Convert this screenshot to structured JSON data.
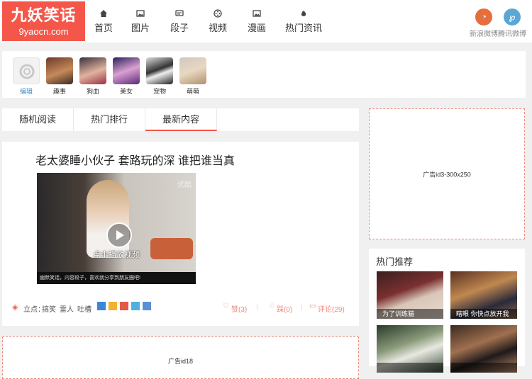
{
  "logo": {
    "title": "九妖笑话",
    "domain": "9yaocn.com"
  },
  "nav": [
    {
      "label": "首页",
      "icon": "home-icon"
    },
    {
      "label": "图片",
      "icon": "image-icon"
    },
    {
      "label": "段子",
      "icon": "chat-icon"
    },
    {
      "label": "视频",
      "icon": "video-icon"
    },
    {
      "label": "漫画",
      "icon": "comic-icon"
    },
    {
      "label": "热门资讯",
      "icon": "fire-icon"
    }
  ],
  "login": {
    "weibo_label": "新浪微博",
    "tencent_label": "腾讯微博"
  },
  "categories": {
    "edit_label": "编辑",
    "items": [
      {
        "label": "趣事"
      },
      {
        "label": "狗血"
      },
      {
        "label": "美女"
      },
      {
        "label": "宠物"
      },
      {
        "label": "萌萌"
      }
    ]
  },
  "tabs": [
    {
      "label": "随机阅读",
      "active": false
    },
    {
      "label": "热门排行",
      "active": false
    },
    {
      "label": "最新内容",
      "active": true
    }
  ],
  "post": {
    "title": "老太婆睡小伙子 套路玩的深 谁把谁当真",
    "video_watermark": "优酷",
    "video_caption": "点击播放视频",
    "video_footer": "幽默笑话，内容段子，喜欢就分享到朋友圈吧!",
    "tag_label": "立点：",
    "tags": [
      "搞笑",
      "雷人",
      "吐槽"
    ],
    "likes": "赞(3)",
    "dislikes": "踩(0)",
    "comments": "评论(29)"
  },
  "ads": {
    "side": "广告id3-300x250",
    "bottom": "广告id18"
  },
  "hot": {
    "title": "热门推荐",
    "items": [
      {
        "caption": "为了训练猫"
      },
      {
        "caption": "瞎眼 你快点放开我"
      },
      {
        "caption": ""
      },
      {
        "caption": ""
      }
    ]
  },
  "colors": {
    "brand": "#f4574a",
    "weibo": "#e66d3c",
    "tencent": "#5aa7d6"
  }
}
